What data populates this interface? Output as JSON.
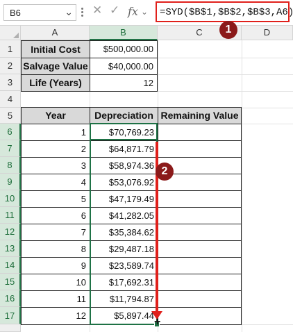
{
  "formula_bar": {
    "name_box": "B6",
    "formula": "=SYD($B$1,$B$2,$B$3,A6)",
    "fx_label": "fx"
  },
  "columns": [
    "A",
    "B",
    "C",
    "D"
  ],
  "rows": [
    "1",
    "2",
    "3",
    "4",
    "5",
    "6",
    "7",
    "8",
    "9",
    "10",
    "11",
    "12",
    "13",
    "14",
    "15",
    "16",
    "17"
  ],
  "inputs": [
    {
      "label": "Initial Cost",
      "value": "$500,000.00"
    },
    {
      "label": "Salvage Value",
      "value": "$40,000.00"
    },
    {
      "label": "Life (Years)",
      "value": "12"
    }
  ],
  "table": {
    "headers": [
      "Year",
      "Depreciation",
      "Remaining Value"
    ],
    "rows": [
      {
        "year": "1",
        "depreciation": "$70,769.23",
        "remaining": ""
      },
      {
        "year": "2",
        "depreciation": "$64,871.79",
        "remaining": ""
      },
      {
        "year": "3",
        "depreciation": "$58,974.36",
        "remaining": ""
      },
      {
        "year": "4",
        "depreciation": "$53,076.92",
        "remaining": ""
      },
      {
        "year": "5",
        "depreciation": "$47,179.49",
        "remaining": ""
      },
      {
        "year": "6",
        "depreciation": "$41,282.05",
        "remaining": ""
      },
      {
        "year": "7",
        "depreciation": "$35,384.62",
        "remaining": ""
      },
      {
        "year": "8",
        "depreciation": "$29,487.18",
        "remaining": ""
      },
      {
        "year": "9",
        "depreciation": "$23,589.74",
        "remaining": ""
      },
      {
        "year": "10",
        "depreciation": "$17,692.31",
        "remaining": ""
      },
      {
        "year": "11",
        "depreciation": "$11,794.87",
        "remaining": ""
      },
      {
        "year": "12",
        "depreciation": "$5,897.44",
        "remaining": ""
      }
    ]
  },
  "annotations": {
    "badge1": "1",
    "badge2": "2"
  },
  "colors": {
    "accent_red": "#e0201b",
    "badge": "#8b1a1a",
    "selection_green": "#1e7145",
    "header_fill": "#d9d9d9"
  }
}
